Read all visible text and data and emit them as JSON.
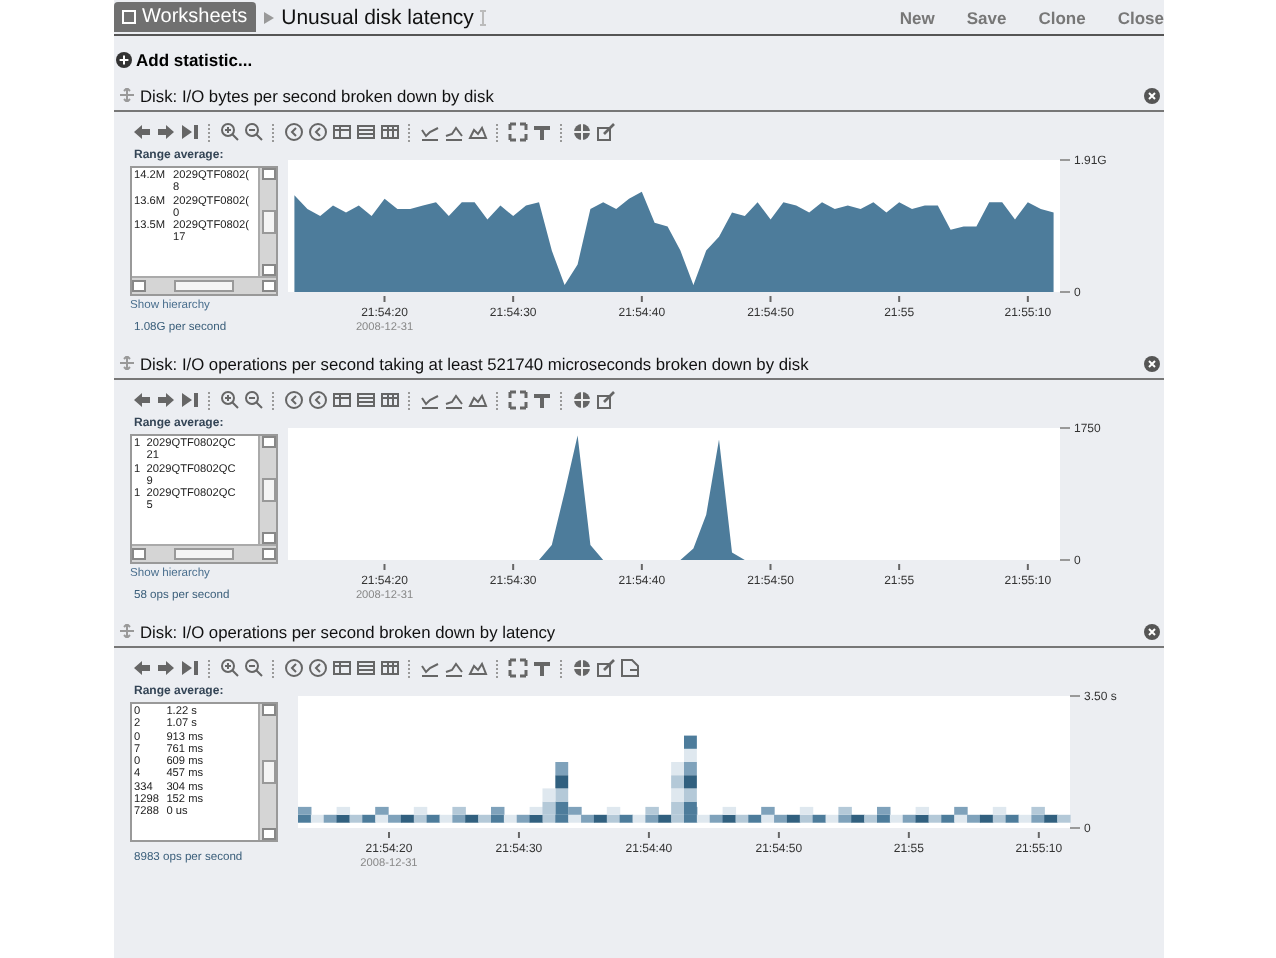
{
  "top_bar": {
    "tab": "Worksheets",
    "title": "Unusual disk latency",
    "actions": [
      "New",
      "Save",
      "Clone",
      "Close"
    ]
  },
  "add_statistic": "Add statistic...",
  "panels": [
    {
      "title": "Disk: I/O bytes per second broken down by disk",
      "kind": "area",
      "export_tool": false,
      "h_scroll": true,
      "range_label": "Range average:",
      "legend": [
        {
          "value": "14.2M",
          "name": "2029QTF0802(",
          "suffix": "8"
        },
        {
          "value": "13.6M",
          "name": "2029QTF0802(",
          "suffix": "0"
        },
        {
          "value": "13.5M",
          "name": "2029QTF0802(",
          "suffix": "17"
        }
      ],
      "hierarchy_link": "Show hierarchy",
      "rate": "1.08G per second",
      "date_label": "2008-12-31",
      "chart_data": {
        "type": "area",
        "categories": [
          null,
          null,
          null,
          null,
          null,
          null,
          null,
          "21:54:20",
          null,
          null,
          null,
          null,
          null,
          null,
          null,
          null,
          null,
          "21:54:30",
          null,
          null,
          null,
          null,
          null,
          null,
          null,
          null,
          null,
          "21:54:40",
          null,
          null,
          null,
          null,
          null,
          null,
          null,
          null,
          null,
          "21:54:50",
          null,
          null,
          null,
          null,
          null,
          null,
          null,
          null,
          null,
          "21:55",
          null,
          null,
          null,
          null,
          null,
          null,
          null,
          null,
          null,
          "21:55:10",
          null,
          null
        ],
        "series": [
          {
            "color": "#4d7c9b",
            "values": [
              1.4,
              1.2,
              1.1,
              1.25,
              1.15,
              1.25,
              1.1,
              1.35,
              1.2,
              1.2,
              1.25,
              1.3,
              1.1,
              1.3,
              1.3,
              1.05,
              1.25,
              1.1,
              1.25,
              1.3,
              0.6,
              0.1,
              0.4,
              1.2,
              1.3,
              1.2,
              1.35,
              1.45,
              1.0,
              0.95,
              0.6,
              0.1,
              0.6,
              0.8,
              1.15,
              1.1,
              1.3,
              1.05,
              1.3,
              1.25,
              1.15,
              1.3,
              1.2,
              1.25,
              1.2,
              1.3,
              1.15,
              1.3,
              1.2,
              1.25,
              1.25,
              0.9,
              0.95,
              0.95,
              1.3,
              1.3,
              1.05,
              1.3,
              1.2,
              1.15
            ]
          }
        ],
        "ylim": [
          0,
          1.91
        ],
        "yticks": [
          {
            "value": 0,
            "label": "0"
          },
          {
            "value": 1.91,
            "label": "1.91G"
          }
        ]
      }
    },
    {
      "title": "Disk: I/O operations per second taking at least 521740 microseconds broken down by disk",
      "kind": "area",
      "export_tool": false,
      "h_scroll": true,
      "range_label": "Range average:",
      "legend": [
        {
          "value": "1",
          "name": "2029QTF0802QC",
          "suffix": "21"
        },
        {
          "value": "1",
          "name": "2029QTF0802QC",
          "suffix": "9"
        },
        {
          "value": "1",
          "name": "2029QTF0802QC",
          "suffix": "5"
        }
      ],
      "hierarchy_link": "Show hierarchy",
      "rate": "58 ops per second",
      "date_label": "2008-12-31",
      "chart_data": {
        "type": "area",
        "categories": [
          null,
          null,
          null,
          null,
          null,
          null,
          null,
          "21:54:20",
          null,
          null,
          null,
          null,
          null,
          null,
          null,
          null,
          null,
          "21:54:30",
          null,
          null,
          null,
          null,
          null,
          null,
          null,
          null,
          null,
          "21:54:40",
          null,
          null,
          null,
          null,
          null,
          null,
          null,
          null,
          null,
          "21:54:50",
          null,
          null,
          null,
          null,
          null,
          null,
          null,
          null,
          null,
          "21:55",
          null,
          null,
          null,
          null,
          null,
          null,
          null,
          null,
          null,
          "21:55:10",
          null,
          null
        ],
        "series": [
          {
            "color": "#4d7c9b",
            "values": [
              0,
              0,
              0,
              0,
              0,
              0,
              0,
              0,
              0,
              0,
              0,
              0,
              0,
              0,
              0,
              0,
              0,
              0,
              0,
              0,
              200,
              900,
              1650,
              200,
              0,
              0,
              0,
              0,
              0,
              0,
              0,
              150,
              600,
              1600,
              100,
              0,
              0,
              0,
              0,
              0,
              0,
              0,
              0,
              0,
              0,
              0,
              0,
              0,
              0,
              0,
              0,
              0,
              0,
              0,
              0,
              0,
              0,
              0,
              0,
              0
            ]
          }
        ],
        "ylim": [
          0,
          1750
        ],
        "yticks": [
          {
            "value": 0,
            "label": "0"
          },
          {
            "value": 1750,
            "label": "1750"
          }
        ]
      }
    },
    {
      "title": "Disk: I/O operations per second broken down by latency",
      "kind": "heatmap",
      "export_tool": true,
      "h_scroll": false,
      "range_label": "Range average:",
      "legend": [
        {
          "value": "0",
          "name": "1.22 s"
        },
        {
          "value": "2",
          "name": "1.07 s"
        },
        {
          "value": "0",
          "name": "913 ms"
        },
        {
          "value": "7",
          "name": "761 ms"
        },
        {
          "value": "0",
          "name": "609 ms"
        },
        {
          "value": "4",
          "name": "457 ms"
        },
        {
          "value": "334",
          "name": "304 ms"
        },
        {
          "value": "1298",
          "name": "152 ms"
        },
        {
          "value": "7288",
          "name": "0 us"
        }
      ],
      "rate": "8983 ops per second",
      "date_label": "2008-12-31",
      "heatmap": {
        "xticks": [
          "21:54:20",
          "21:54:30",
          "21:54:40",
          "21:54:50",
          "21:55",
          "21:55:10"
        ],
        "ytop": "3.50 s",
        "ybottom": "0"
      }
    }
  ]
}
